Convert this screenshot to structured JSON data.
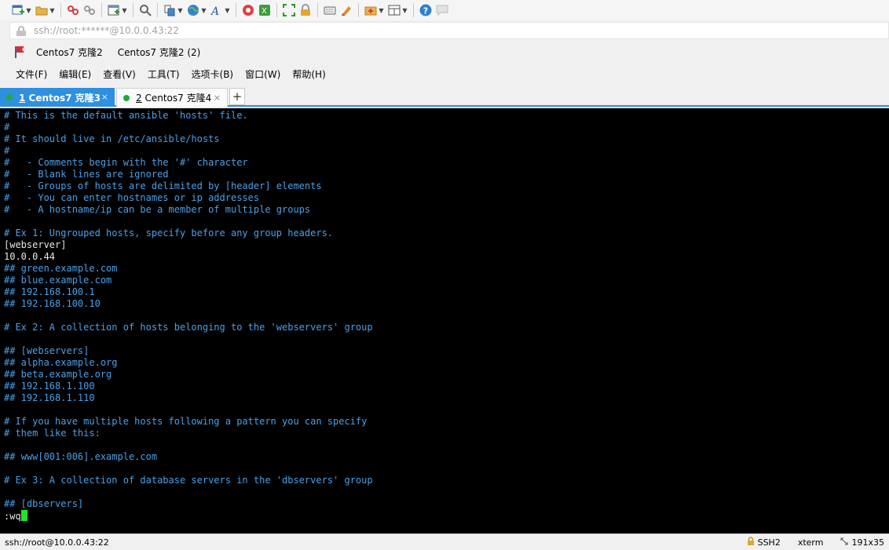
{
  "toolbar": {
    "icons": [
      "new-session-icon",
      "open-folder-icon",
      "disconnect-icon",
      "reconnect-icon",
      "new-tab-icon",
      "find-icon",
      "transfer-icon",
      "globe-icon",
      "font-icon",
      "xftp-icon",
      "xmanager-icon",
      "fullscreen-icon",
      "lock-icon",
      "keyboard-icon",
      "highlight-icon",
      "compose-icon",
      "layout-icon",
      "help-icon",
      "chat-icon"
    ]
  },
  "address": {
    "text": "ssh://root:******@10.0.0.43:22"
  },
  "bookmarks": {
    "items": [
      "Centos7 克隆2",
      "Centos7 克隆2 (2)"
    ]
  },
  "menu": {
    "items": [
      "文件(F)",
      "编辑(E)",
      "查看(V)",
      "工具(T)",
      "选项卡(B)",
      "窗口(W)",
      "帮助(H)"
    ]
  },
  "tabs": [
    {
      "num": "1",
      "label": " Centos7 克隆3",
      "close": "×"
    },
    {
      "num": "2",
      "label": " Centos7 克隆4",
      "close": "×"
    }
  ],
  "tab_add_label": "+",
  "terminal": {
    "lines": [
      {
        "text": "# This is the default ansible 'hosts' file.",
        "style": "comment"
      },
      {
        "text": "#",
        "style": "comment"
      },
      {
        "text": "# It should live in /etc/ansible/hosts",
        "style": "comment"
      },
      {
        "text": "#",
        "style": "comment"
      },
      {
        "text": "#   - Comments begin with the '#' character",
        "style": "comment"
      },
      {
        "text": "#   - Blank lines are ignored",
        "style": "comment"
      },
      {
        "text": "#   - Groups of hosts are delimited by [header] elements",
        "style": "comment"
      },
      {
        "text": "#   - You can enter hostnames or ip addresses",
        "style": "comment"
      },
      {
        "text": "#   - A hostname/ip can be a member of multiple groups",
        "style": "comment"
      },
      {
        "text": "",
        "style": "plain"
      },
      {
        "text": "# Ex 1: Ungrouped hosts, specify before any group headers.",
        "style": "comment"
      },
      {
        "text": "[webserver]",
        "style": "plain"
      },
      {
        "text": "10.0.0.44",
        "style": "plain"
      },
      {
        "text": "## green.example.com",
        "style": "comment"
      },
      {
        "text": "## blue.example.com",
        "style": "comment"
      },
      {
        "text": "## 192.168.100.1",
        "style": "comment"
      },
      {
        "text": "## 192.168.100.10",
        "style": "comment"
      },
      {
        "text": "",
        "style": "plain"
      },
      {
        "text": "# Ex 2: A collection of hosts belonging to the 'webservers' group",
        "style": "comment"
      },
      {
        "text": "",
        "style": "plain"
      },
      {
        "text": "## [webservers]",
        "style": "comment"
      },
      {
        "text": "## alpha.example.org",
        "style": "comment"
      },
      {
        "text": "## beta.example.org",
        "style": "comment"
      },
      {
        "text": "## 192.168.1.100",
        "style": "comment"
      },
      {
        "text": "## 192.168.1.110",
        "style": "comment"
      },
      {
        "text": "",
        "style": "plain"
      },
      {
        "text": "# If you have multiple hosts following a pattern you can specify",
        "style": "comment"
      },
      {
        "text": "# them like this:",
        "style": "comment"
      },
      {
        "text": "",
        "style": "plain"
      },
      {
        "text": "## www[001:006].example.com",
        "style": "comment"
      },
      {
        "text": "",
        "style": "plain"
      },
      {
        "text": "# Ex 3: A collection of database servers in the 'dbservers' group",
        "style": "comment"
      },
      {
        "text": "",
        "style": "plain"
      },
      {
        "text": "## [dbservers]",
        "style": "comment"
      }
    ],
    "command": ":wq"
  },
  "status": {
    "connection": "ssh://root@10.0.0.43:22",
    "protocol": "SSH2",
    "terminal_type": "xterm",
    "size": "191x35"
  },
  "colors": {
    "accent": "#2f8fe0",
    "comment": "#4aa0e8",
    "cursor": "#22e622",
    "status_dot": "#1faa3a"
  }
}
